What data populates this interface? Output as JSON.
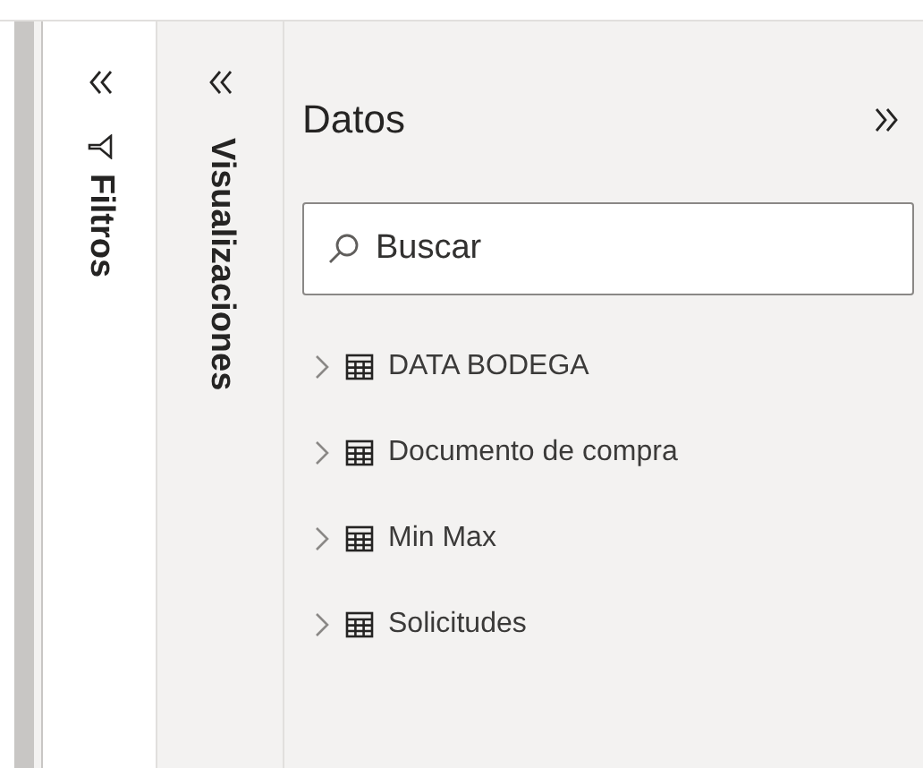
{
  "filters_pane": {
    "title": "Filtros"
  },
  "visualizations_pane": {
    "title": "Visualizaciones"
  },
  "data_pane": {
    "title": "Datos",
    "search": {
      "placeholder": "Buscar"
    },
    "tables": [
      {
        "name": "DATA BODEGA",
        "expanded": false
      },
      {
        "name": "Documento de compra",
        "expanded": false
      },
      {
        "name": "Min Max",
        "expanded": false
      },
      {
        "name": "Solicitudes",
        "expanded": false
      }
    ]
  }
}
